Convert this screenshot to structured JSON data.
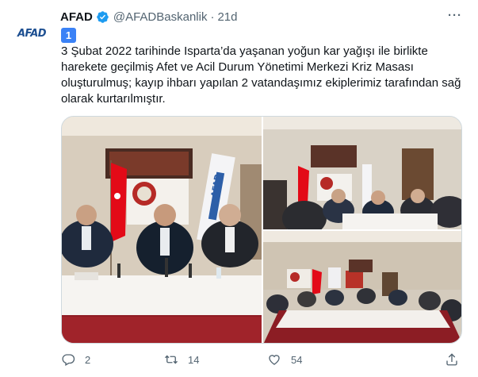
{
  "avatar": {
    "label": "AFAD"
  },
  "author": {
    "name": "AFAD",
    "handle": "@AFADBaskanlik",
    "separator": "·",
    "time": "21d",
    "more": "···"
  },
  "badge": {
    "label": "1"
  },
  "tweet": {
    "lines": [
      "3 Şubat 2022 tarihinde Isparta’da yaşanan yoğun kar yağışı ile birlikte",
      "harekete geçilmiş Afet ve Acil Durum Yönetimi Merkezi Kriz Masası",
      "oluşturulmuş; kayıp ihbarı yapılan 2 vatandaşımız ekiplerimiz tarafından sağ",
      "olarak kurtarılmıştır."
    ]
  },
  "media": {
    "banner_text": "AFAD"
  },
  "actions": {
    "reply_count": "2",
    "retweet_count": "14",
    "like_count": "54"
  },
  "icons": {
    "verified": "verified-badge-icon",
    "reply": "reply-icon",
    "retweet": "retweet-icon",
    "like": "heart-icon",
    "share": "share-icon",
    "more": "more-icon"
  },
  "colors": {
    "verified": "#1d9bf0",
    "muted": "#536471",
    "badge": "#3b82f6",
    "flag": "#e30a17",
    "afad_blue": "#1d4f91"
  }
}
